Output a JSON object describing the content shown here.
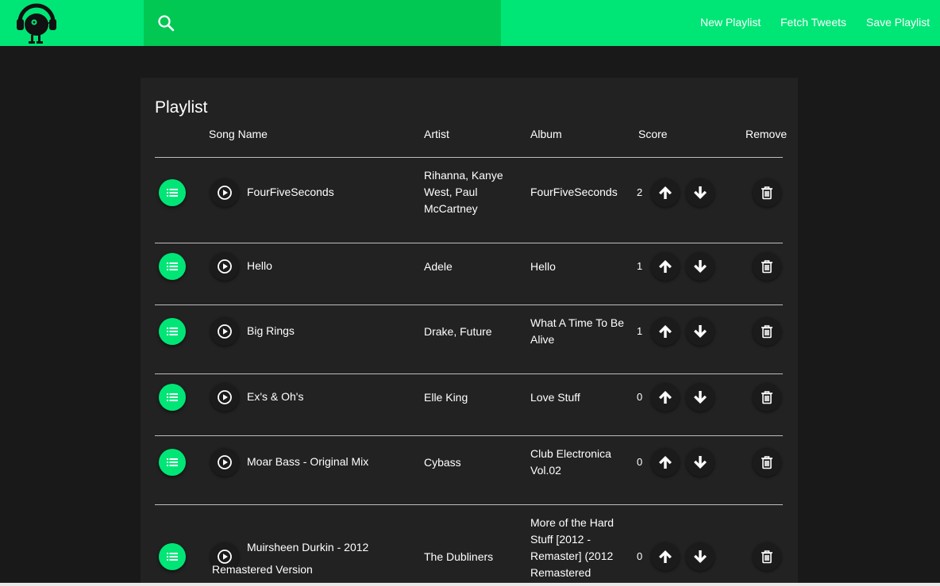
{
  "header": {
    "logo_icon": "headphones-creature-logo",
    "search": {
      "icon": "search-icon",
      "value": "",
      "placeholder": ""
    },
    "nav": [
      {
        "label": "New Playlist"
      },
      {
        "label": "Fetch Tweets"
      },
      {
        "label": "Save Playlist"
      }
    ],
    "colors": {
      "bar": "#00e676",
      "search": "#00c853"
    }
  },
  "playlist": {
    "title": "Playlist",
    "columns": {
      "song": "Song Name",
      "artist": "Artist",
      "album": "Album",
      "score": "Score",
      "remove": "Remove"
    },
    "rows": [
      {
        "song": "FourFiveSeconds",
        "artist": "Rihanna, Kanye West, Paul McCartney",
        "album": "FourFiveSeconds",
        "score": "2"
      },
      {
        "song": "Hello",
        "artist": "Adele",
        "album": "Hello",
        "score": "1"
      },
      {
        "song": "Big Rings",
        "artist": "Drake, Future",
        "album": "What A Time To Be Alive",
        "score": "1"
      },
      {
        "song": "Ex's & Oh's",
        "artist": "Elle King",
        "album": "Love Stuff",
        "score": "0"
      },
      {
        "song": "Moar Bass - Original Mix",
        "artist": "Cybass",
        "album": "Club Electronica Vol.02",
        "score": "0"
      },
      {
        "song": "Muirsheen Durkin - 2012",
        "song_cont": "Remastered Version",
        "artist": "The Dubliners",
        "album": "More of the Hard Stuff [2012 - Remaster] (2012 Remastered",
        "score": "0"
      }
    ],
    "icons": {
      "drag": "list-icon",
      "play": "play-icon",
      "upvote": "arrow-up-icon",
      "downvote": "arrow-down-icon",
      "remove": "trash-icon"
    },
    "colors": {
      "accent": "#00e676",
      "background": "#191919",
      "panel": "#222222"
    }
  }
}
